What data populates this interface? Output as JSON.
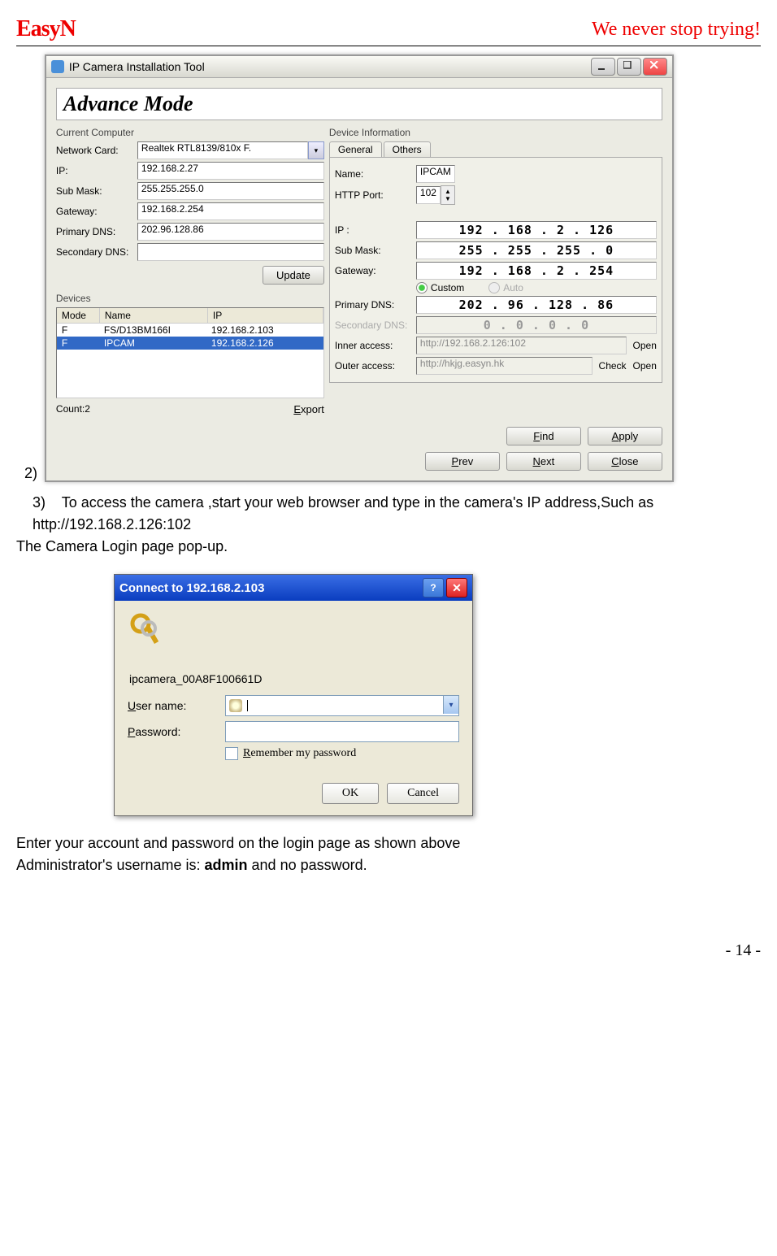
{
  "header": {
    "logo": "EasyN",
    "slogan": "We never stop trying!"
  },
  "install_window": {
    "title": "IP Camera Installation Tool",
    "mode": "Advance Mode",
    "current_computer": {
      "label": "Current Computer",
      "network_card": {
        "label": "Network Card:",
        "value": "Realtek RTL8139/810x F."
      },
      "ip": {
        "label": "IP:",
        "value": "192.168.2.27"
      },
      "sub_mask": {
        "label": "Sub Mask:",
        "value": "255.255.255.0"
      },
      "gateway": {
        "label": "Gateway:",
        "value": "192.168.2.254"
      },
      "primary_dns": {
        "label": "Primary DNS:",
        "value": "202.96.128.86"
      },
      "secondary_dns": {
        "label": "Secondary DNS:",
        "value": ""
      },
      "update_btn": "Update"
    },
    "devices": {
      "label": "Devices",
      "cols": {
        "mode": "Mode",
        "name": "Name",
        "ip": "IP"
      },
      "rows": [
        {
          "mode": "F",
          "name": "FS/D13BM166I",
          "ip": "192.168.2.103",
          "selected": false
        },
        {
          "mode": "F",
          "name": "IPCAM",
          "ip": "192.168.2.126",
          "selected": true
        }
      ],
      "count_label": "Count:2",
      "export_btn": "Export"
    },
    "device_info": {
      "label": "Device Information",
      "tab_general": "General",
      "tab_others": "Others",
      "name": {
        "label": "Name:",
        "value": "IPCAM"
      },
      "http_port": {
        "label": "HTTP Port:",
        "value": "102"
      },
      "ip": {
        "label": "IP  :",
        "value": "192 . 168 .  2  . 126"
      },
      "sub_mask": {
        "label": "Sub Mask:",
        "value": "255 . 255 . 255 .  0"
      },
      "gateway": {
        "label": "Gateway:",
        "value": "192 . 168 .  2  . 254"
      },
      "dns_mode": {
        "custom": "Custom",
        "auto": "Auto"
      },
      "primary_dns": {
        "label": "Primary DNS:",
        "value": "202 . 96  . 128 . 86"
      },
      "secondary_dns": {
        "label": "Secondary DNS:",
        "value": " 0  .  0  .  0  .  0"
      },
      "inner": {
        "label": "Inner access:",
        "value": "http://192.168.2.126:102",
        "open": "Open"
      },
      "outer": {
        "label": "Outer access:",
        "value": "http://hkjg.easyn.hk",
        "check": "Check",
        "open": "Open"
      }
    },
    "footer": {
      "find": "Find",
      "apply": "Apply",
      "prev": "Prev",
      "next": "Next",
      "close": "Close"
    }
  },
  "step2": "2)",
  "step3": {
    "num": "3)",
    "text": "To access the camera ,start your web browser and type in the camera's IP address,Such as http://192.168.2.126:102"
  },
  "login_popup_text": "The Camera Login page pop-up.",
  "login_window": {
    "title": "Connect to 192.168.2.103",
    "realm": "ipcamera_00A8F100661D",
    "user_label": "User name:",
    "user_value": "",
    "pass_label": "Password:",
    "remember": "Remember my password",
    "ok": "OK",
    "cancel": "Cancel"
  },
  "footer_text": {
    "line1": "Enter your account and password on the login page as shown above",
    "line2a": "Administrator's username is: ",
    "line2b": "admin",
    "line2c": " and no password."
  },
  "page_num": "- 14 -"
}
